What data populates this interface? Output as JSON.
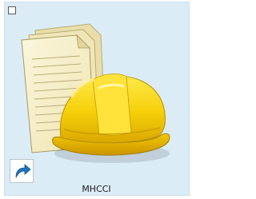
{
  "desktop_icon": {
    "label": "MHCCI",
    "selected": true,
    "checkbox_checked": false,
    "icon": "documents-with-hard-hat-icon",
    "overlay": "shortcut-arrow-icon"
  },
  "colors": {
    "selection_fill": "#dbecf7",
    "selection_border": "#cbe0ee",
    "hard_hat": "#f5d10a",
    "paper": "#f6efc5",
    "shortcut_arrow": "#1e73be"
  }
}
